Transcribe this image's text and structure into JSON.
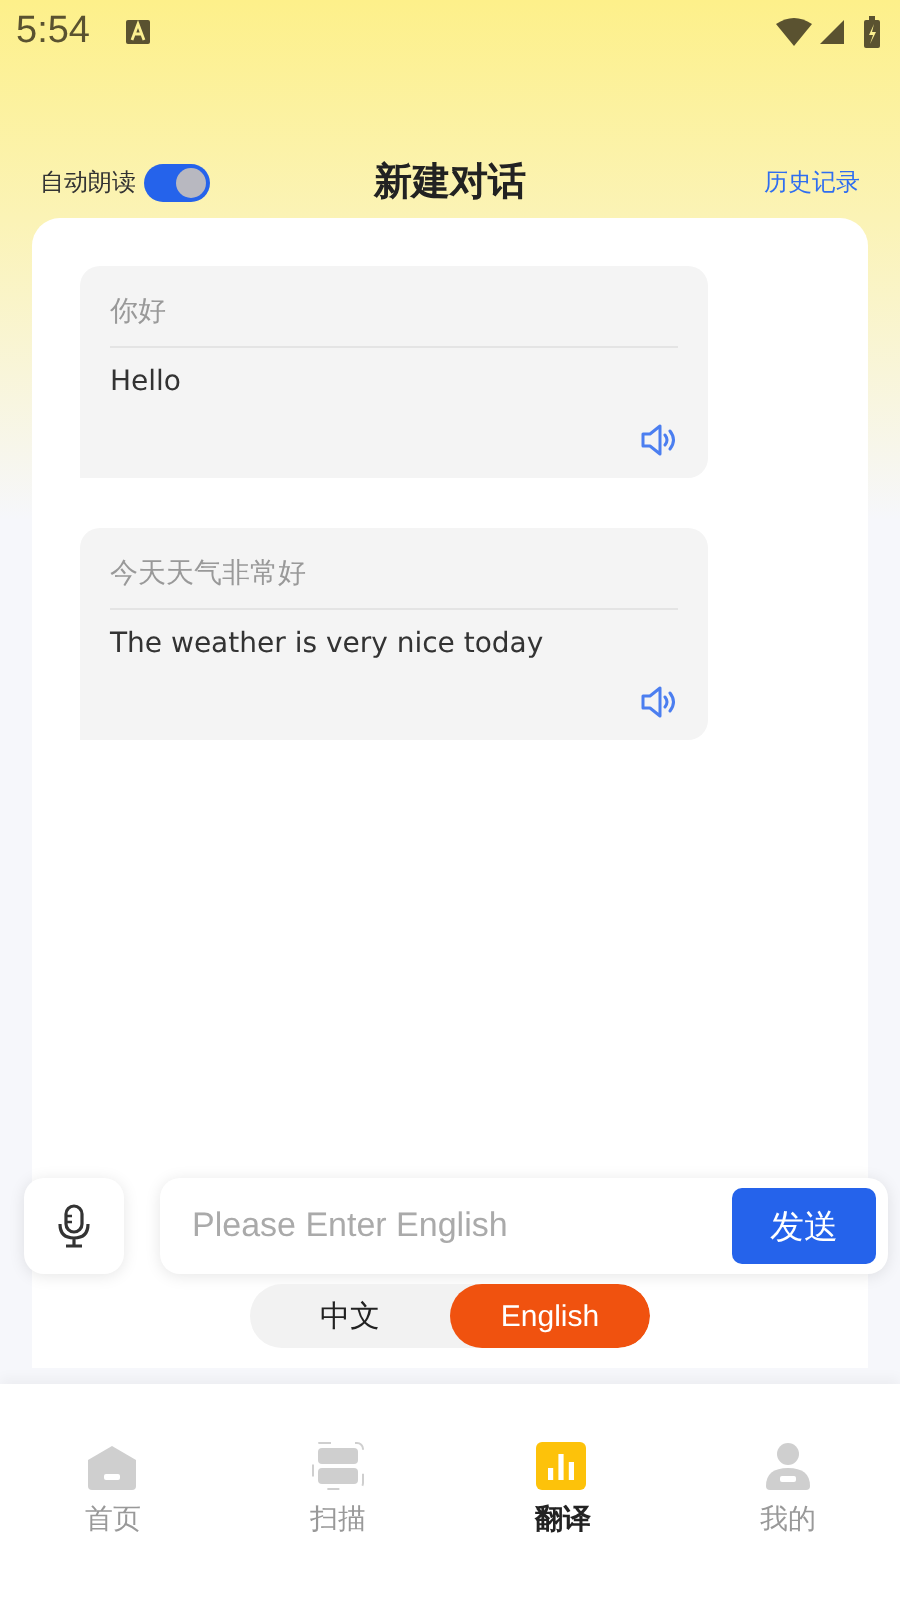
{
  "status_bar": {
    "time": "5:54"
  },
  "header": {
    "auto_read": {
      "label": "自动朗读",
      "on": true
    },
    "title": "新建对话",
    "history_link": "历史记录"
  },
  "messages": [
    {
      "source": "你好",
      "translation": "Hello"
    },
    {
      "source": "今天天气非常好",
      "translation": "The weather is very nice today"
    }
  ],
  "input": {
    "placeholder": "Please Enter English",
    "send_button": "发送"
  },
  "language_toggle": [
    {
      "label": "中文",
      "selected": false
    },
    {
      "label": "English",
      "selected": true
    }
  ],
  "nav": [
    {
      "label": "首页",
      "kind": "home",
      "selected": false
    },
    {
      "label": "扫描",
      "kind": "scan",
      "selected": false
    },
    {
      "label": "翻译",
      "kind": "chart",
      "selected": true
    },
    {
      "label": "我的",
      "kind": "person",
      "selected": false
    }
  ]
}
